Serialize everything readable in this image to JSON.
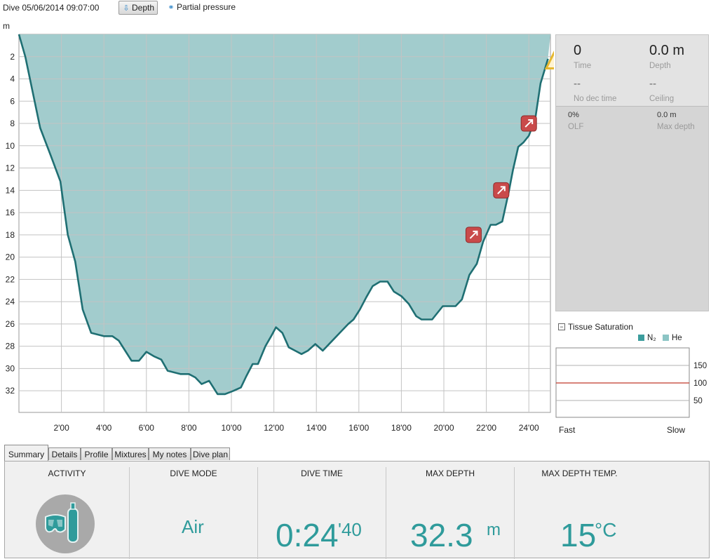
{
  "toolbar": {
    "dive_title": "Dive 05/06/2014 09:07:00",
    "depth_label": "Depth",
    "partial_pressure_label": "Partial pressure",
    "unit_label": "m"
  },
  "chart_data": {
    "type": "area",
    "title": "",
    "xlabel": "",
    "ylabel": "m",
    "xlim": [
      0,
      25
    ],
    "ylim": [
      0,
      34
    ],
    "y_inverted": true,
    "grid": true,
    "x_ticks": [
      "2'00",
      "4'00",
      "6'00",
      "8'00",
      "10'00",
      "12'00",
      "14'00",
      "16'00",
      "18'00",
      "20'00",
      "22'00",
      "24'00"
    ],
    "x_tick_values": [
      2,
      4,
      6,
      8,
      10,
      12,
      14,
      16,
      18,
      20,
      22,
      24
    ],
    "y_ticks": [
      2,
      4,
      6,
      8,
      10,
      12,
      14,
      16,
      18,
      20,
      22,
      24,
      26,
      28,
      30,
      32
    ],
    "series": [
      {
        "x": [
          0,
          0.3,
          1.0,
          1.5,
          1.95,
          2.3,
          2.65,
          3.0,
          3.4,
          4.0,
          4.4,
          4.7,
          5.0,
          5.3,
          5.65,
          6.0,
          6.35,
          6.7,
          7.0,
          7.6,
          8.0,
          8.3,
          8.6,
          8.95,
          9.35,
          9.7,
          10.1,
          10.45,
          10.7,
          11.0,
          11.25,
          11.6,
          11.9,
          12.1,
          12.4,
          12.7,
          13.0,
          13.3,
          13.6,
          13.95,
          14.3,
          14.7,
          15.1,
          15.5,
          15.75,
          16.05,
          16.35,
          16.65,
          17.0,
          17.35,
          17.65,
          18.0,
          18.35,
          18.7,
          18.95,
          19.45,
          19.95,
          20.25,
          20.55,
          20.85,
          21.2,
          21.55,
          21.85,
          22.2,
          22.45,
          22.75,
          23.05,
          23.25,
          23.5,
          23.75,
          24.0,
          24.3,
          24.55,
          24.9
        ],
        "y": [
          0,
          2.0,
          8.4,
          10.9,
          13.2,
          18.0,
          20.4,
          24.7,
          26.8,
          27.1,
          27.1,
          27.5,
          28.4,
          29.3,
          29.3,
          28.5,
          28.9,
          29.2,
          30.2,
          30.5,
          30.5,
          30.8,
          31.4,
          31.1,
          32.3,
          32.3,
          32.0,
          31.7,
          30.7,
          29.6,
          29.6,
          28.0,
          27.0,
          26.3,
          26.8,
          28.1,
          28.4,
          28.7,
          28.4,
          27.8,
          28.4,
          27.6,
          26.8,
          26.0,
          25.6,
          24.7,
          23.6,
          22.6,
          22.2,
          22.2,
          23.1,
          23.5,
          24.2,
          25.3,
          25.6,
          25.6,
          24.4,
          24.4,
          24.4,
          23.8,
          21.6,
          20.6,
          18.6,
          17.1,
          17.1,
          16.8,
          14.2,
          12.2,
          10.1,
          9.7,
          9.1,
          7.6,
          4.4,
          2.2
        ]
      }
    ],
    "markers": [
      {
        "type": "ascent-rate-warning-icon",
        "x": 21.4,
        "y": 18.0
      },
      {
        "type": "ascent-rate-warning-icon",
        "x": 22.7,
        "y": 14.0
      },
      {
        "type": "ascent-rate-warning-icon",
        "x": 24.0,
        "y": 8.0
      },
      {
        "type": "alarm-triangle-icon",
        "x": 24.95,
        "y": 2.3
      }
    ],
    "colors": {
      "fill": "#a2cccd",
      "line": "#1f6f73",
      "grid": "#c3c3c3",
      "marker": "#c94a4a",
      "alarm": "#e6b830"
    }
  },
  "info": {
    "time_value": "0",
    "time_label": "Time",
    "depth_value": "0.0 m",
    "depth_label": "Depth",
    "no_dec_value": "--",
    "no_dec_label": "No dec time",
    "ceiling_value": "--",
    "ceiling_label": "Ceiling",
    "olf_value": "0%",
    "olf_label": "OLF",
    "max_depth_value": "0.0 m",
    "max_depth_label": "Max depth"
  },
  "tissue": {
    "title": "Tissue Saturation",
    "toggle": "−",
    "n2_label": "N₂",
    "he_label": "He",
    "ticks": [
      "150",
      "100",
      "50"
    ],
    "tick_values": [
      150,
      100,
      50
    ],
    "limit_value": 100,
    "fast_label": "Fast",
    "slow_label": "Slow",
    "colors": {
      "n2": "#3c9d9d",
      "he": "#8cc5c5",
      "limit": "#c0392b"
    }
  },
  "tabs": [
    "Summary",
    "Details",
    "Profile",
    "Mixtures",
    "My notes",
    "Dive plan"
  ],
  "summary": {
    "activity_title": "ACTIVITY",
    "dive_mode_title": "DIVE MODE",
    "dive_mode_value": "Air",
    "dive_time_title": "DIVE TIME",
    "dive_time_main": "0:24",
    "dive_time_sec": "'40",
    "max_depth_title": "MAX DEPTH",
    "max_depth_value": "32.3",
    "max_depth_unit": "m",
    "max_temp_title": "MAX DEPTH TEMP.",
    "max_temp_value": "15",
    "max_temp_unit": "°C",
    "accent": "#2f9b9b"
  }
}
